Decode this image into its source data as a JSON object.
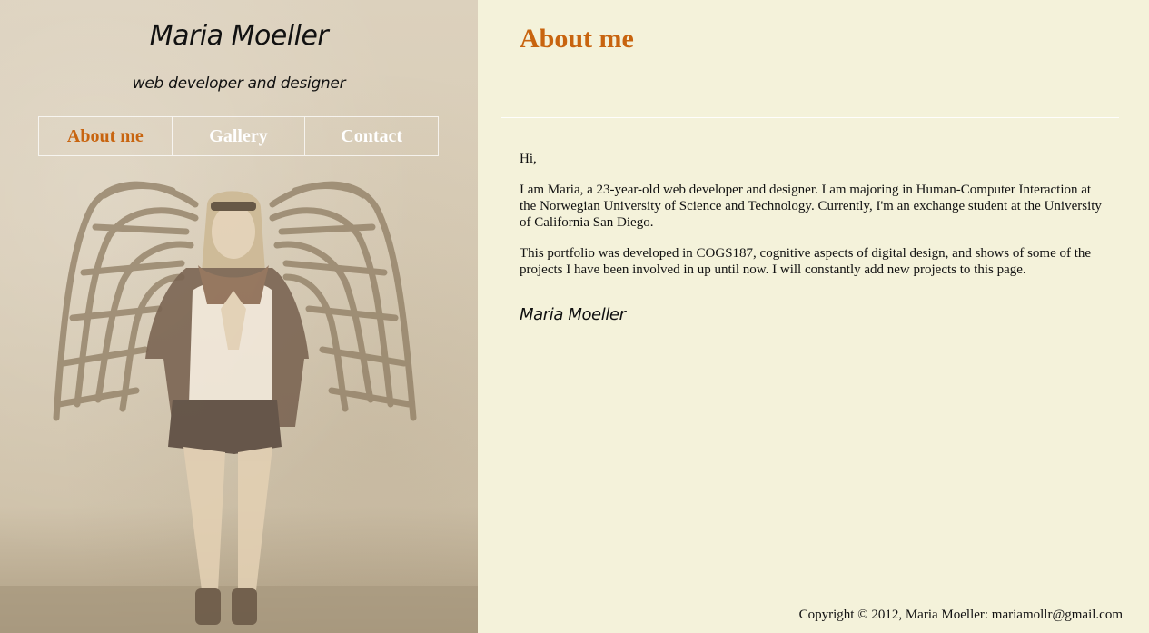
{
  "site": {
    "title": "Maria Moeller",
    "subtitle": "web developer and designer"
  },
  "nav": {
    "items": [
      {
        "label": "About me",
        "active": true
      },
      {
        "label": "Gallery",
        "active": false
      },
      {
        "label": "Contact",
        "active": false
      }
    ]
  },
  "content": {
    "title": "About me",
    "greeting": "Hi,",
    "paragraph1": "I am Maria, a 23-year-old web developer and designer. I am majoring in Human-Computer Interaction at the Norwegian University of Science and Technology. Currently, I'm an exchange student at the University of California San Diego.",
    "paragraph2": "This portfolio was developed in COGS187, cognitive aspects of digital design, and shows of some of the projects I have been involved in up until now. I will constantly add new projects to this page.",
    "signature": "Maria Moeller"
  },
  "footer": {
    "text": "Copyright © 2012, Maria Moeller: mariamollr@gmail.com"
  },
  "colors": {
    "accent": "#c8640f",
    "background": "#f4f2da",
    "nav_text": "#ffffff"
  }
}
